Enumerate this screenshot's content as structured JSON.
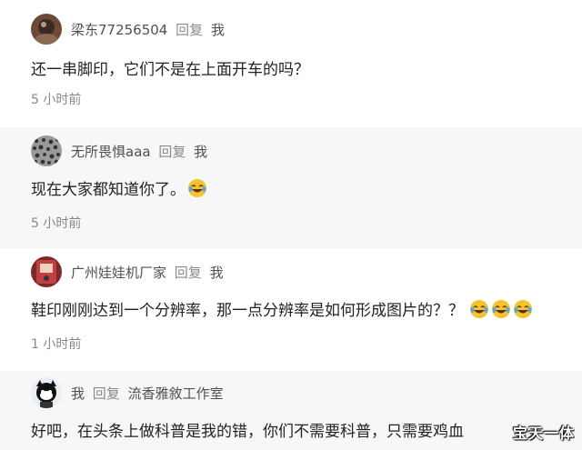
{
  "comments": [
    {
      "author": "梁东77256504",
      "reply_label": "回复",
      "reply_to": "我",
      "text": "还一串脚印，它们不是在上面开车的吗？",
      "time": "5 小时前",
      "avatar_icon": "user-avatar-photo-icon"
    },
    {
      "author": "无所畏惧aaa",
      "reply_label": "回复",
      "reply_to": "我",
      "text": "现在大家都知道你了。",
      "time": "5 小时前",
      "emoji_count": 1,
      "avatar_icon": "user-avatar-pattern-icon"
    },
    {
      "author": "广州娃娃机厂家",
      "reply_label": "回复",
      "reply_to": "我",
      "text": "鞋印刚刚达到一个分辨率，那一点分辨率是如何形成图片的？？",
      "time": "1 小时前",
      "emoji_count": 3,
      "avatar_icon": "user-avatar-photo-icon"
    },
    {
      "author": "我",
      "reply_label": "回复",
      "reply_to": "流香雅敘工作室",
      "text": "好吧，在头条上做科普是我的错，你们不需要科普，只需要鸡血",
      "avatar_icon": "user-avatar-cartoon-icon"
    }
  ],
  "watermark": "宝天一体",
  "colors": {
    "text": "#222222",
    "meta": "#505050",
    "reply": "#8a8a8a",
    "time": "#888888",
    "alt_bg": "#f7f7f8"
  }
}
